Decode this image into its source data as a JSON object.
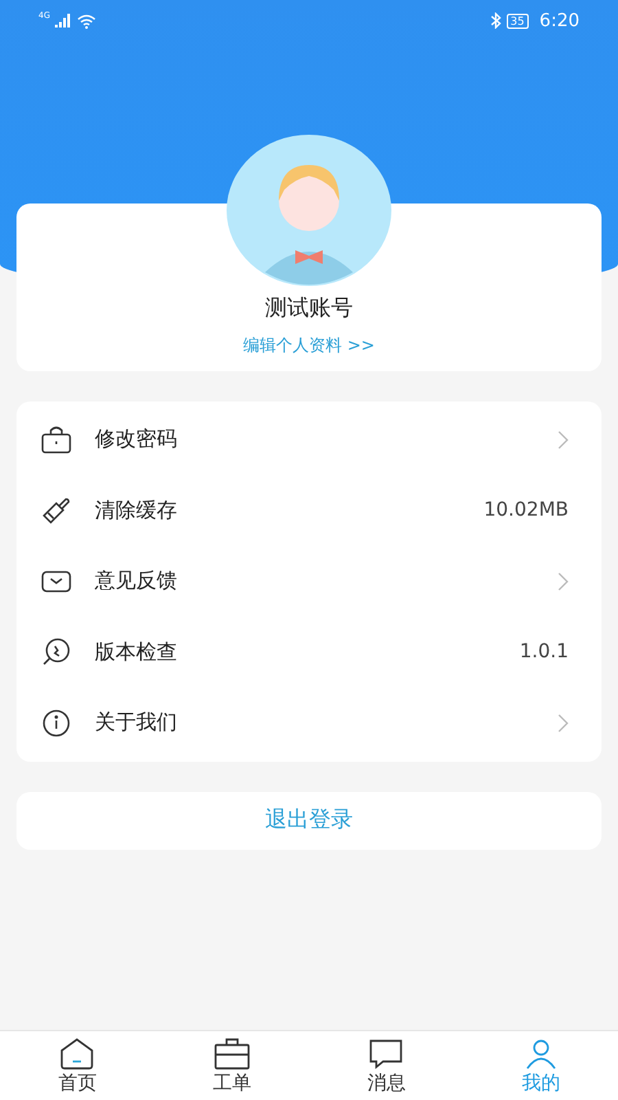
{
  "status_bar": {
    "network": "4G",
    "battery": "35",
    "time": "6:20"
  },
  "profile": {
    "name": "测试账号",
    "edit_link": "编辑个人资料 >>"
  },
  "menu": [
    {
      "label": "修改密码",
      "kind": "arrow"
    },
    {
      "label": "清除缓存",
      "kind": "value",
      "value": "10.02MB"
    },
    {
      "label": "意见反馈",
      "kind": "arrow"
    },
    {
      "label": "版本检查",
      "kind": "value",
      "value": "1.0.1"
    },
    {
      "label": "关于我们",
      "kind": "arrow"
    }
  ],
  "logout_button": "退出登录",
  "tabs": [
    {
      "label": "首页",
      "selected": false
    },
    {
      "label": "工单",
      "selected": false
    },
    {
      "label": "消息",
      "selected": false
    },
    {
      "label": "我的",
      "selected": true
    }
  ]
}
